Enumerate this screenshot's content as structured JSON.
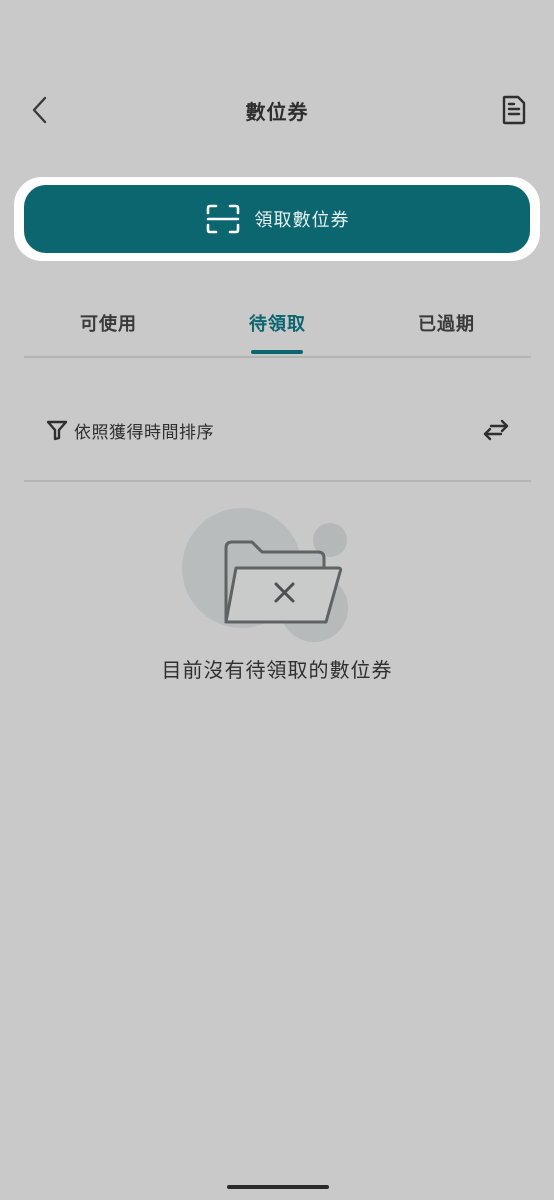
{
  "header": {
    "title": "數位券",
    "back_icon": "chevron-left-icon",
    "document_icon": "document-icon"
  },
  "claim_button": {
    "label": "領取數位券",
    "icon": "scan-icon"
  },
  "tabs": [
    {
      "label": "可使用",
      "active": false
    },
    {
      "label": "待領取",
      "active": true
    },
    {
      "label": "已過期",
      "active": false
    }
  ],
  "sort": {
    "filter_icon": "filter-icon",
    "label": "依照獲得時間排序",
    "swap_icon": "swap-icon"
  },
  "empty_state": {
    "illustration": "empty-folder-icon",
    "message": "目前沒有待領取的數位券"
  },
  "colors": {
    "accent": "#0b6670",
    "background": "#c8c9c8",
    "text": "#2f2f2f"
  }
}
